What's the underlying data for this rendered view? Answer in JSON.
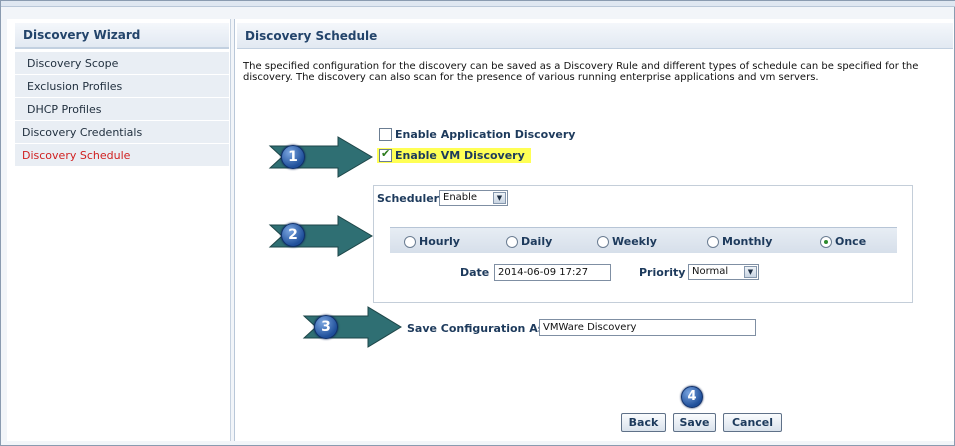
{
  "sidebar": {
    "title": "Discovery Wizard",
    "items": [
      {
        "label": "Discovery Scope",
        "level": "sub",
        "active": false
      },
      {
        "label": "Exclusion Profiles",
        "level": "sub",
        "active": false
      },
      {
        "label": "DHCP Profiles",
        "level": "sub",
        "active": false
      },
      {
        "label": "Discovery Credentials",
        "level": "top",
        "active": false
      },
      {
        "label": "Discovery Schedule",
        "level": "top",
        "active": true
      }
    ]
  },
  "main": {
    "title": "Discovery Schedule",
    "description": "The specified configuration for the discovery can be saved as a Discovery Rule and different types of schedule can be specified for the discovery. The discovery can also scan for the presence of various running enterprise applications and vm servers.",
    "enable_app_discovery": {
      "label": "Enable Application Discovery",
      "checked": false
    },
    "enable_vm_discovery": {
      "label": "Enable VM Discovery",
      "checked": true
    },
    "scheduler": {
      "label": "Scheduler",
      "value": "Enable"
    },
    "frequency": {
      "options": [
        "Hourly",
        "Daily",
        "Weekly",
        "Monthly",
        "Once"
      ],
      "selected": "Once"
    },
    "date": {
      "label": "Date",
      "value": "2014-06-09 17:27"
    },
    "priority": {
      "label": "Priority",
      "value": "Normal"
    },
    "save_config": {
      "label": "Save Configuration As",
      "value": "VMWare Discovery"
    },
    "buttons": {
      "back": "Back",
      "save": "Save",
      "cancel": "Cancel"
    }
  },
  "callouts": [
    "1",
    "2",
    "3",
    "4"
  ],
  "colors": {
    "accent": "#23446b",
    "active_item": "#d02020",
    "highlight": "#ffff55",
    "arrow": "#2f6f73"
  }
}
